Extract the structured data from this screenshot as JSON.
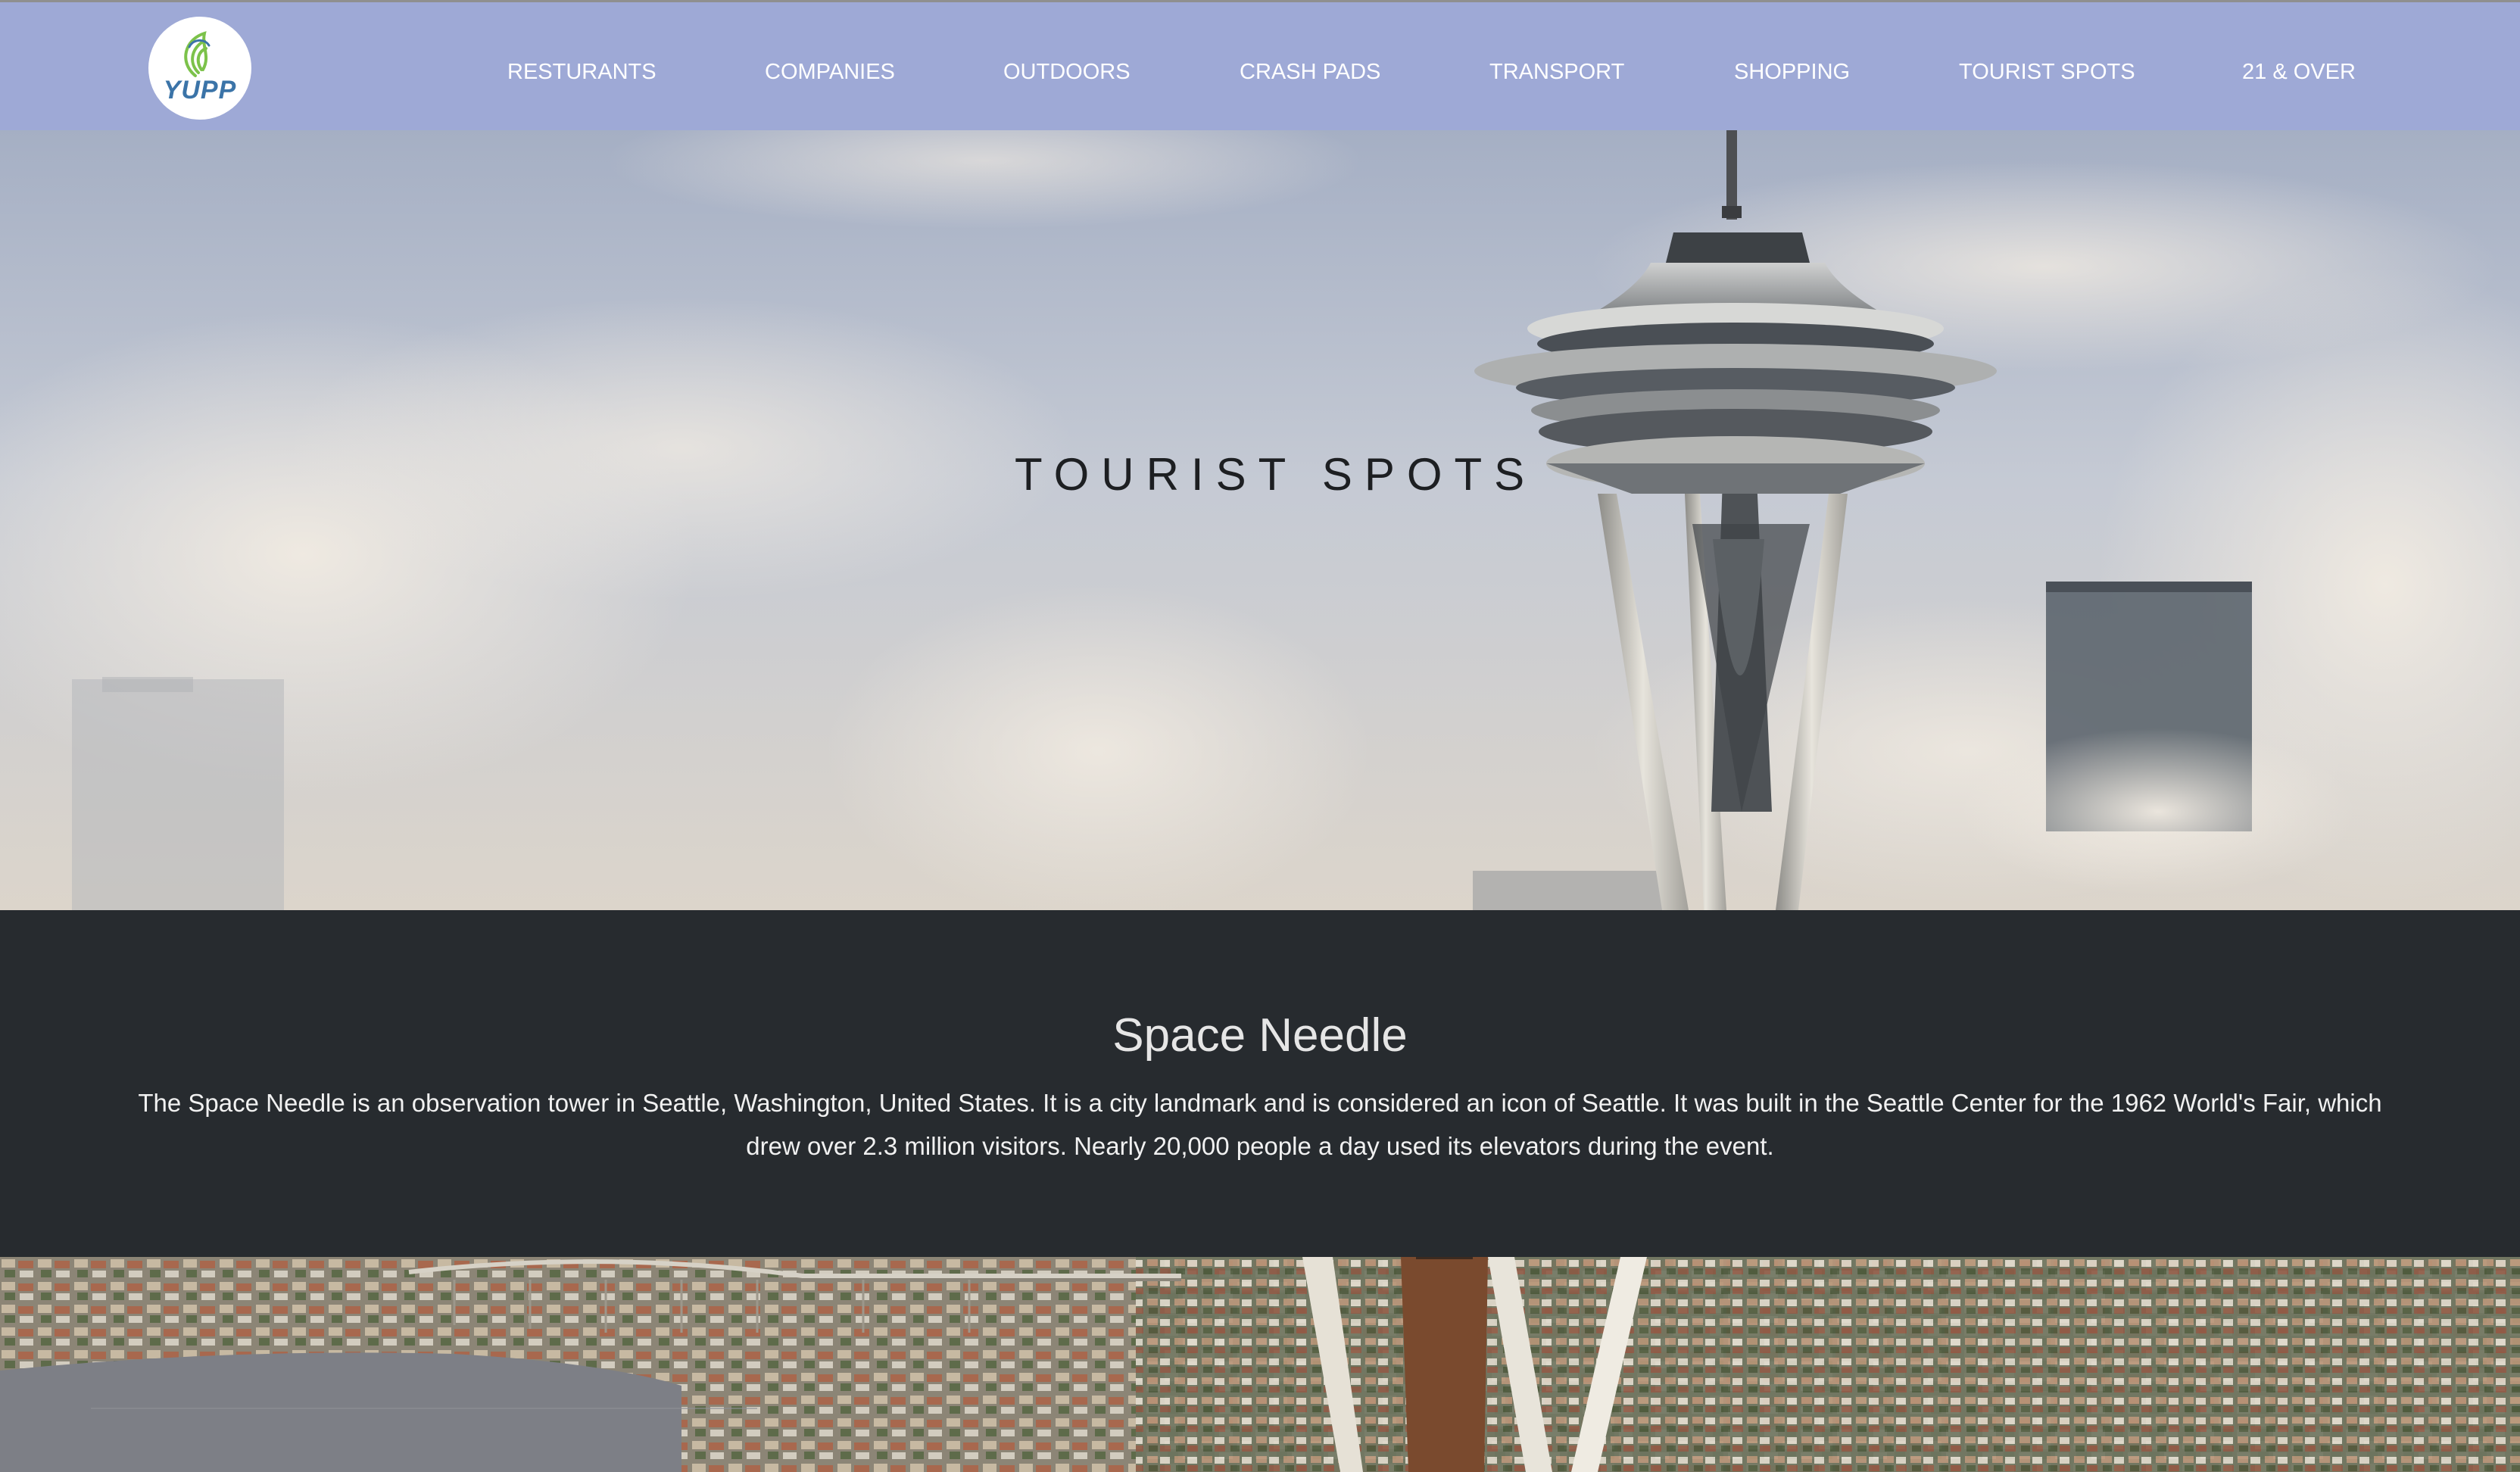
{
  "brand": {
    "logo_text": "YUPP"
  },
  "nav": {
    "items": [
      {
        "label": "RESTURANTS"
      },
      {
        "label": "COMPANIES"
      },
      {
        "label": "OUTDOORS"
      },
      {
        "label": "CRASH PADS"
      },
      {
        "label": "TRANSPORT"
      },
      {
        "label": "SHOPPING"
      },
      {
        "label": "TOURIST SPOTS"
      },
      {
        "label": "21 & OVER"
      }
    ]
  },
  "hero": {
    "title": "TOURIST SPOTS"
  },
  "spot": {
    "name": "Space Needle",
    "description": "The Space Needle is an observation tower in Seattle, Washington, United States. It is a city landmark and is considered an icon of Seattle. It was built in the Seattle Center for the 1962 World's Fair, which drew over 2.3 million visitors. Nearly 20,000 people a day used its elevators during the event."
  },
  "colors": {
    "navbar_bg": "#9ea9d6",
    "content_bg": "#272b2f",
    "logo_accent": "#3b74a8",
    "logo_leaf": "#7cc24a"
  },
  "icons": {
    "logo": "yupp-logo-icon"
  }
}
